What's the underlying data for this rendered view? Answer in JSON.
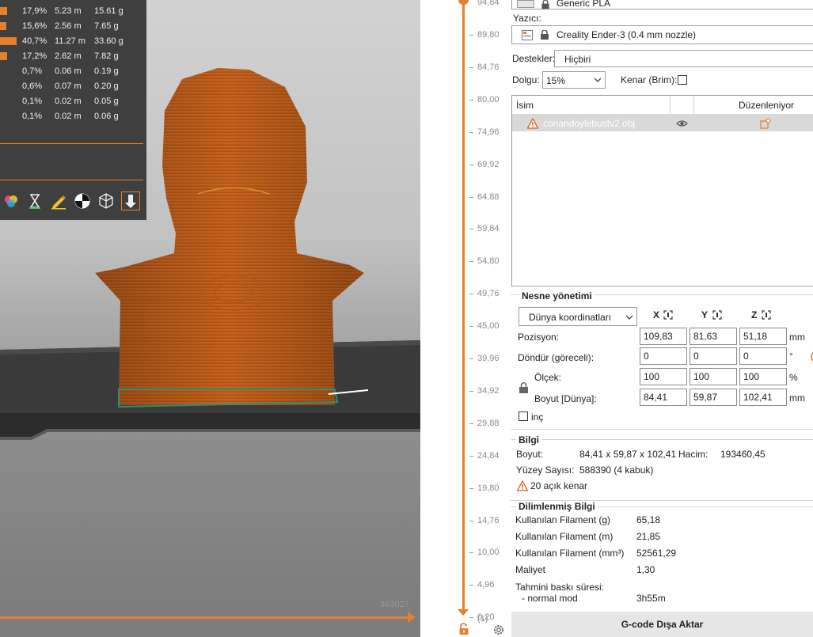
{
  "stats": {
    "rows": [
      {
        "pct": "17,9%",
        "len": "5.23 m",
        "wt": "15.61 g",
        "fraction": 0.179
      },
      {
        "pct": "15,6%",
        "len": "2.56 m",
        "wt": "7.65 g",
        "fraction": 0.156
      },
      {
        "pct": "40,7%",
        "len": "11.27 m",
        "wt": "33.60 g",
        "fraction": 0.407
      },
      {
        "pct": "17,2%",
        "len": "2.62 m",
        "wt": "7.82 g",
        "fraction": 0.172
      },
      {
        "pct": "0,7%",
        "len": "0.06 m",
        "wt": "0.19 g",
        "fraction": 0.007
      },
      {
        "pct": "0,6%",
        "len": "0.07 m",
        "wt": "0.20 g",
        "fraction": 0.006
      },
      {
        "pct": "0,1%",
        "len": "0.02 m",
        "wt": "0.05 g",
        "fraction": 0.001
      },
      {
        "pct": "0,1%",
        "len": "0.02 m",
        "wt": "0.06 g",
        "fraction": 0.001
      }
    ],
    "icons": [
      "color-palette-icon",
      "hourglass-icon",
      "pencil-icon",
      "checker-icon",
      "wireframe-cube-icon",
      "export-arrow-icon"
    ]
  },
  "viewport": {
    "move_count": "363027"
  },
  "layer_slider": {
    "top_partial": "94,84",
    "ticks": [
      "89,80",
      "84,76",
      "80,00",
      "74,96",
      "69,92",
      "64,88",
      "59,84",
      "54,80",
      "49,76",
      "45,00",
      "39,96",
      "34,92",
      "29,88",
      "24,84",
      "19,80",
      "14,76",
      "10,00",
      "4,96",
      "0,20"
    ],
    "lowest_layer_label": "(1)"
  },
  "panel": {
    "filament": "Generic PLA",
    "printer_label": "Yazıcı:",
    "printer": "Creality Ender-3 (0.4 mm nozzle)",
    "support_label": "Destekler:",
    "support_value": "Hiçbiri",
    "infill_label": "Dolgu:",
    "infill_value": "15%",
    "brim_label": "Kenar (Brim):",
    "list": {
      "col_name": "İsim",
      "col_editing": "Düzenleniyor",
      "object": "conandoylebustv2.obj"
    },
    "object_manipulation": {
      "title": "Nesne yönetimi",
      "coord_system": "Dünya koordinatları",
      "axes": [
        "X",
        "Y",
        "Z"
      ],
      "position_label": "Pozisyon:",
      "position": [
        "109,83",
        "81,63",
        "51,18"
      ],
      "position_unit": "mm",
      "rotate_label": "Döndür (göreceli):",
      "rotate": [
        "0",
        "0",
        "0"
      ],
      "rotate_unit": "°",
      "scale_label": "Ölçek:",
      "scale": [
        "100",
        "100",
        "100"
      ],
      "scale_unit": "%",
      "size_label": "Boyut [Dünya]:",
      "size": [
        "84,41",
        "59,87",
        "102,41"
      ],
      "size_unit": "mm",
      "inch_label": "inç"
    },
    "info": {
      "title": "Bilgi",
      "size_label": "Boyut:",
      "size_value": "84,41 x 59,87 x 102,41",
      "volume_label": "Hacim:",
      "volume_value": "193460,45",
      "facets_label": "Yüzey Sayısı:",
      "facets_value": "588390 (4 kabuk)",
      "open_edges": "20 açık kenar"
    },
    "sliced_info": {
      "title": "Dilimlenmiş Bilgi",
      "filament_g_label": "Kullanılan Filament (g)",
      "filament_g": "65,18",
      "filament_m_label": "Kullanılan Filament (m)",
      "filament_m": "21,85",
      "filament_mm3_label": "Kullanılan Filament (mm³)",
      "filament_mm3": "52561,29",
      "cost_label": "Maliyet",
      "cost": "1,30",
      "print_time_label": "Tahmini baskı süresi:",
      "normal_mode_label": "- normal mod",
      "normal_mode": "3h55m"
    },
    "export_button": "G-code Dışa Aktar"
  },
  "colors": {
    "accent": "#e87f2a",
    "stats_bg": "#3f3f3f",
    "model": "#c8641e"
  }
}
